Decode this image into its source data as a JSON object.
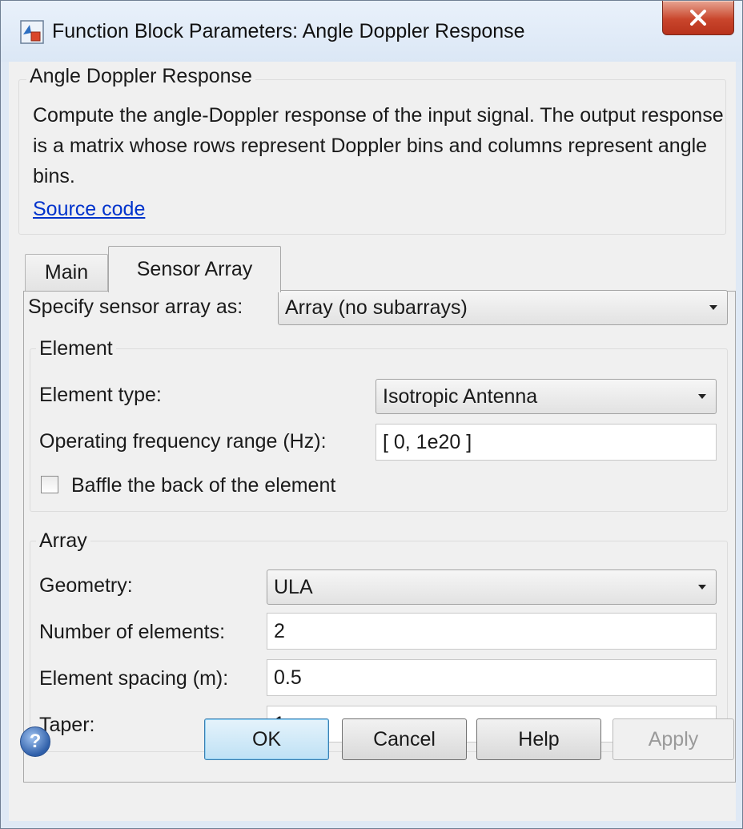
{
  "window": {
    "title": "Function Block Parameters: Angle Doppler Response",
    "close_label": "X"
  },
  "block": {
    "name": "Angle Doppler Response",
    "description": "Compute the angle-Doppler response of the input signal. The output response is a matrix whose rows represent Doppler bins and columns represent angle bins.",
    "source_link": "Source code"
  },
  "tabs": [
    {
      "label": "Main",
      "active": false
    },
    {
      "label": "Sensor Array",
      "active": true
    }
  ],
  "sensor_array": {
    "specify_label": "Specify sensor array as:",
    "specify_value": "Array (no subarrays)"
  },
  "element": {
    "group_label": "Element",
    "type_label": "Element type:",
    "type_value": "Isotropic Antenna",
    "freq_label": "Operating frequency range (Hz):",
    "freq_value": "[ 0, 1e20 ]",
    "baffle_label": "Baffle the back of the element",
    "baffle_checked": false
  },
  "array": {
    "group_label": "Array",
    "geometry_label": "Geometry:",
    "geometry_value": "ULA",
    "num_elements_label": "Number of elements:",
    "num_elements_value": "2",
    "spacing_label": "Element spacing (m):",
    "spacing_value": "0.5",
    "taper_label": "Taper:",
    "taper_value": "1"
  },
  "buttons": {
    "help_icon_glyph": "?",
    "ok": "OK",
    "cancel": "Cancel",
    "help": "Help",
    "apply": "Apply"
  },
  "colors": {
    "ok_accent": "#3c7fb1",
    "link": "#0033cc",
    "close_button": "#c9462c"
  }
}
